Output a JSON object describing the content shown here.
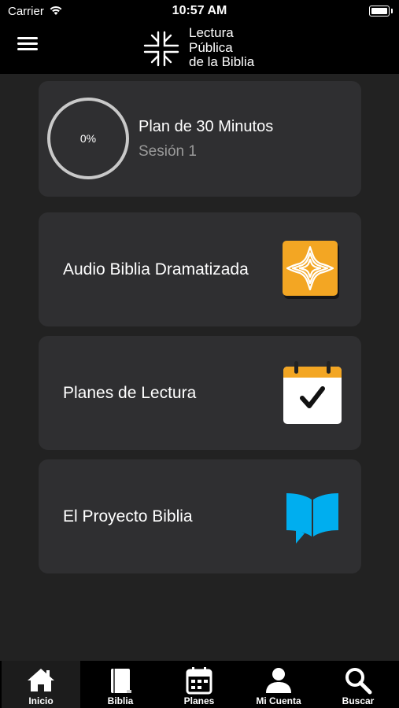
{
  "status_bar": {
    "carrier": "Carrier",
    "time": "10:57 AM"
  },
  "header": {
    "logo_lines": [
      "Lectura",
      "Pública",
      "de la Biblia"
    ]
  },
  "progress_card": {
    "percent_label": "0%",
    "progress": 0,
    "title": "Plan de 30 Minutos",
    "session": "Sesión 1"
  },
  "cards": [
    {
      "label": "Audio Biblia Dramatizada",
      "icon": "cross-app-icon",
      "accent": "#f3a623"
    },
    {
      "label": "Planes de Lectura",
      "icon": "calendar-check-icon",
      "accent": "#f3a623"
    },
    {
      "label": "El Proyecto Biblia",
      "icon": "book-flag-icon",
      "accent": "#00aeef"
    }
  ],
  "tabs": [
    {
      "label": "Inicio",
      "icon": "home-icon",
      "active": true
    },
    {
      "label": "Biblia",
      "icon": "bible-icon",
      "active": false
    },
    {
      "label": "Planes",
      "icon": "calendar-icon",
      "active": false
    },
    {
      "label": "Mi Cuenta",
      "icon": "user-icon",
      "active": false
    },
    {
      "label": "Buscar",
      "icon": "search-icon",
      "active": false
    }
  ]
}
